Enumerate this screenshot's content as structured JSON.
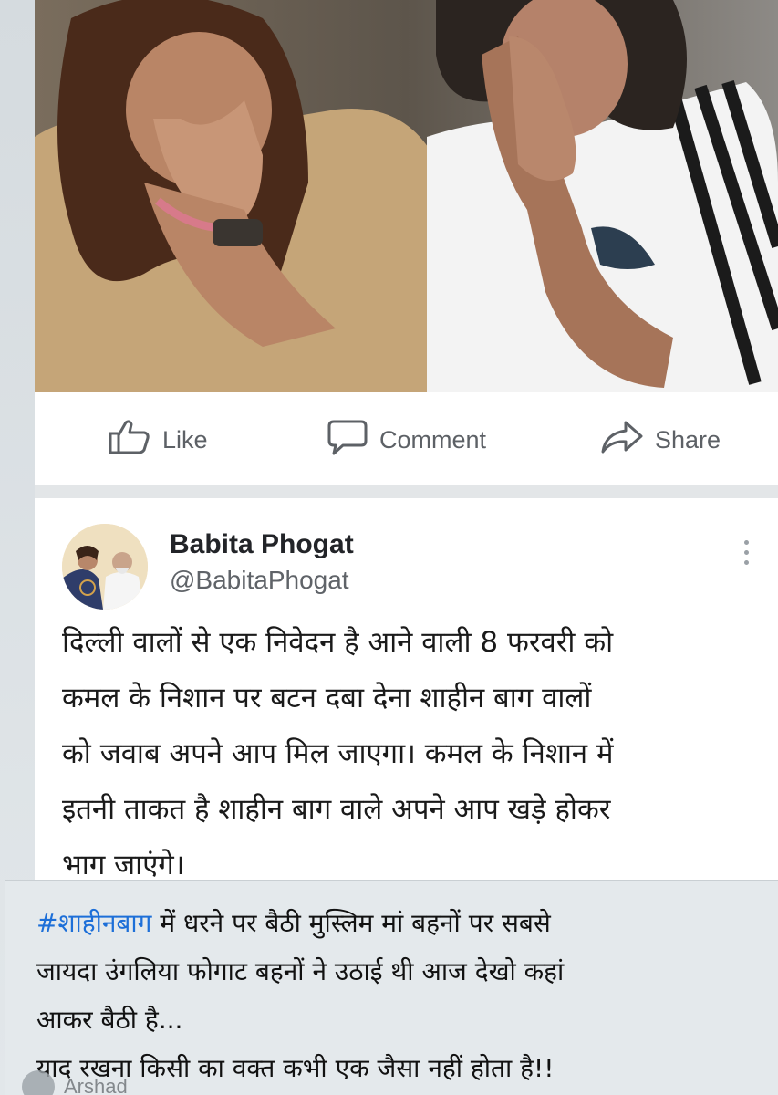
{
  "colors": {
    "accent_link": "#1d6fd8",
    "action_text": "#5d6166",
    "card_bg": "#ffffff",
    "caption_bg": "#e4e9ec"
  },
  "actions": {
    "like": {
      "label": "Like",
      "icon": "thumbs-up-icon"
    },
    "comment": {
      "label": "Comment",
      "icon": "speech-bubble-icon"
    },
    "share": {
      "label": "Share",
      "icon": "share-arrow-icon"
    }
  },
  "tweet": {
    "author_name": "Babita Phogat",
    "author_handle": "@BabitaPhogat",
    "lines": [
      "दिल्ली वालों से एक निवेदन है आने वाली 8 फरवरी को",
      "कमल के निशान पर बटन दबा देना  शाहीन बाग वालों",
      "को जवाब अपने आप मिल जाएगा। कमल के निशान में",
      "इतनी ताकत है शाहीन बाग वाले अपने आप खड़े होकर",
      "भाग जाएंगे।"
    ]
  },
  "caption": {
    "hashtag": "#शाहीनबाग",
    "line1_rest": " में धरने पर बैठी मुस्लिम मां बहनों  पर सबसे",
    "line2": "जायदा उंगलिया फोगाट बहनों ने उठाई थी आज देखो कहां",
    "line3": "आकर बैठी है...",
    "line4": "याद रखना किसी का वक्त कभी एक जैसा नहीं होता है!!"
  },
  "watermark": {
    "name": "Arshad"
  }
}
